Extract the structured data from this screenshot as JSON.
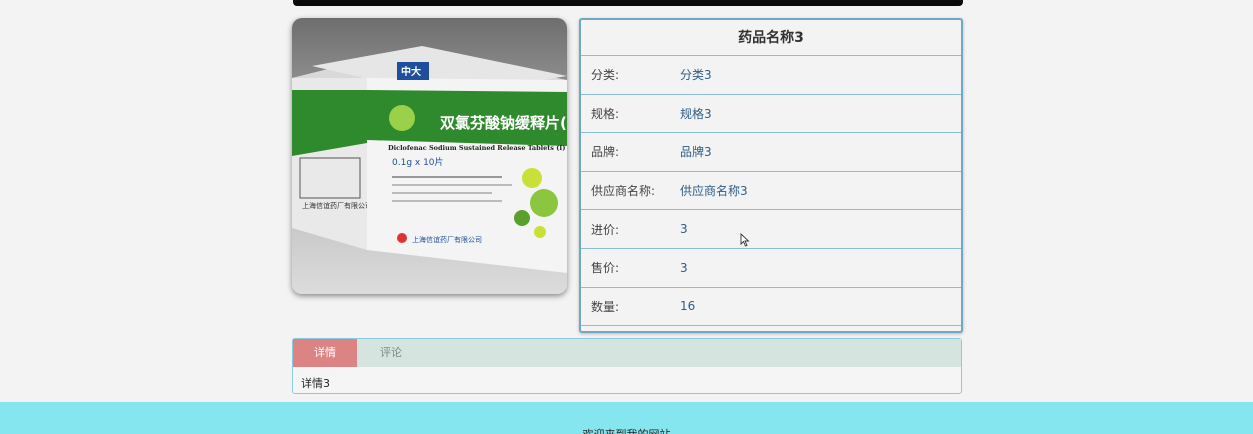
{
  "product": {
    "name": "药品名称3",
    "image_box_text": {
      "brand_logo": "中大",
      "name_cn": "双氯芬酸钠缓释片(I)",
      "name_en": "Diclofenac Sodium Sustained Release Tablets (I)",
      "dosage": "0.1g x 10片",
      "manufacturer": "上海信谊药厂有限公司"
    },
    "fields": [
      {
        "label": "分类:",
        "value": "分类3"
      },
      {
        "label": "规格:",
        "value": "规格3"
      },
      {
        "label": "品牌:",
        "value": "品牌3"
      },
      {
        "label": "供应商名称:",
        "value": "供应商名称3"
      },
      {
        "label": "进价:",
        "value": "3"
      },
      {
        "label": "售价:",
        "value": "3"
      },
      {
        "label": "数量:",
        "value": "16"
      }
    ]
  },
  "tabs": {
    "items": [
      {
        "label": "详情",
        "active": true
      },
      {
        "label": "评论",
        "active": false
      }
    ],
    "content": "详情3"
  },
  "footer": {
    "text": "欢迎来到我的网站"
  },
  "colors": {
    "active_tab": "#dc8484",
    "tab_bar": "#d5e4de",
    "card_border": "#6fa7c4",
    "footer_bg": "#86e6ef"
  }
}
